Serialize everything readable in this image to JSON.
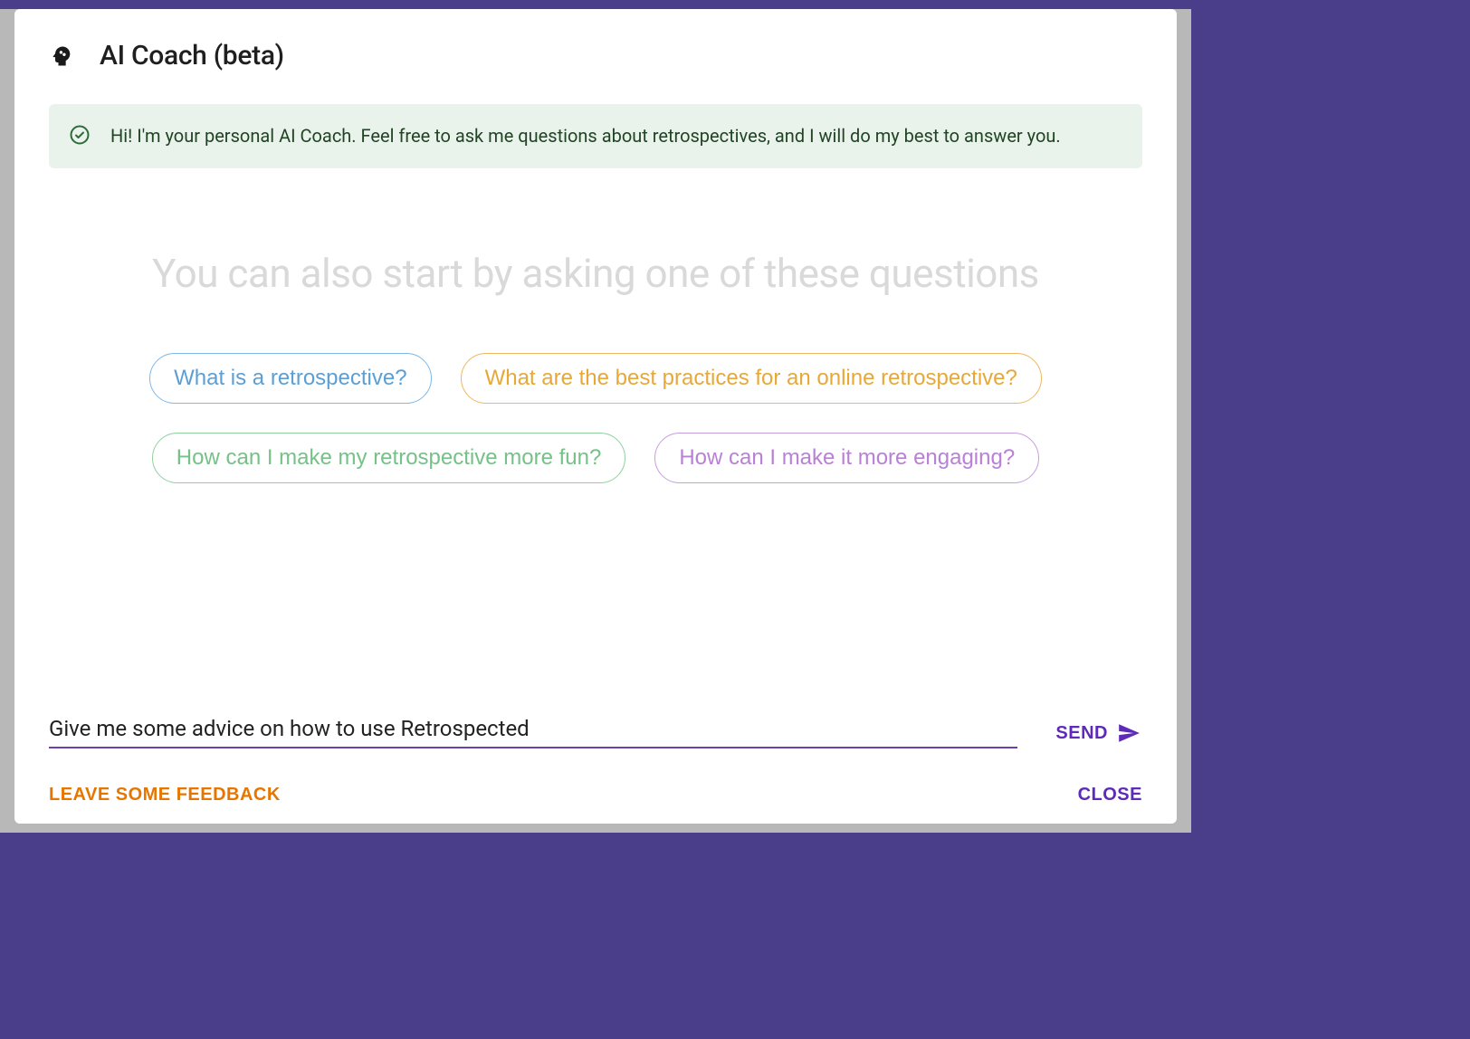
{
  "dialog": {
    "title": "AI Coach (beta)"
  },
  "alert": {
    "text": "Hi! I'm your personal AI Coach. Feel free to ask me questions about retrospectives, and I will do my best to answer you."
  },
  "suggestions": {
    "heading": "You can also start by asking one of these questions",
    "chips": [
      {
        "label": "What is a retrospective?",
        "color": "blue"
      },
      {
        "label": "What are the best practices for an online retrospective?",
        "color": "orange"
      },
      {
        "label": "How can I make my retrospective more fun?",
        "color": "green"
      },
      {
        "label": "How can I make it more engaging?",
        "color": "purple"
      }
    ]
  },
  "input": {
    "value": "Give me some advice on how to use Retrospected",
    "send_label": "SEND"
  },
  "footer": {
    "feedback_label": "LEAVE SOME FEEDBACK",
    "close_label": "CLOSE"
  }
}
